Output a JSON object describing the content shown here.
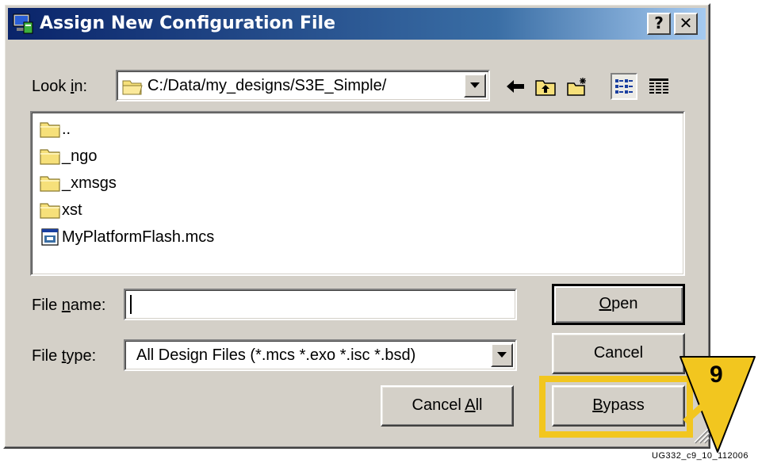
{
  "window": {
    "title": "Assign New Configuration File",
    "help_label": "?",
    "close_label": "✕"
  },
  "look_in": {
    "label_pre": "Look ",
    "label_key": "i",
    "label_post": "n:",
    "path": "C:/Data/my_designs/S3E_Simple/"
  },
  "toolbar": {
    "icons": [
      "back-arrow-icon",
      "up-folder-icon",
      "new-folder-icon",
      "list-view-icon",
      "details-view-icon"
    ]
  },
  "files": [
    {
      "name": "..",
      "icon": "folder-icon"
    },
    {
      "name": "_ngo",
      "icon": "folder-icon"
    },
    {
      "name": "_xmsgs",
      "icon": "folder-icon"
    },
    {
      "name": "xst",
      "icon": "folder-icon"
    },
    {
      "name": "MyPlatformFlash.mcs",
      "icon": "file-icon"
    }
  ],
  "file_name": {
    "label_pre": "File ",
    "label_key": "n",
    "label_post": "ame:",
    "value": ""
  },
  "file_type": {
    "label_pre": "File ",
    "label_key": "t",
    "label_post": "ype:",
    "value": "All Design Files (*.mcs *.exo *.isc *.bsd)"
  },
  "buttons": {
    "open_key": "O",
    "open_rest": "pen",
    "cancel": "Cancel",
    "cancel_all_pre": "Cancel ",
    "cancel_all_key": "A",
    "cancel_all_post": "ll",
    "bypass_key": "B",
    "bypass_rest": "ypass"
  },
  "callout": {
    "number": "9",
    "color": "#f2c61f"
  },
  "figure_id": "UG332_c9_10_112006"
}
